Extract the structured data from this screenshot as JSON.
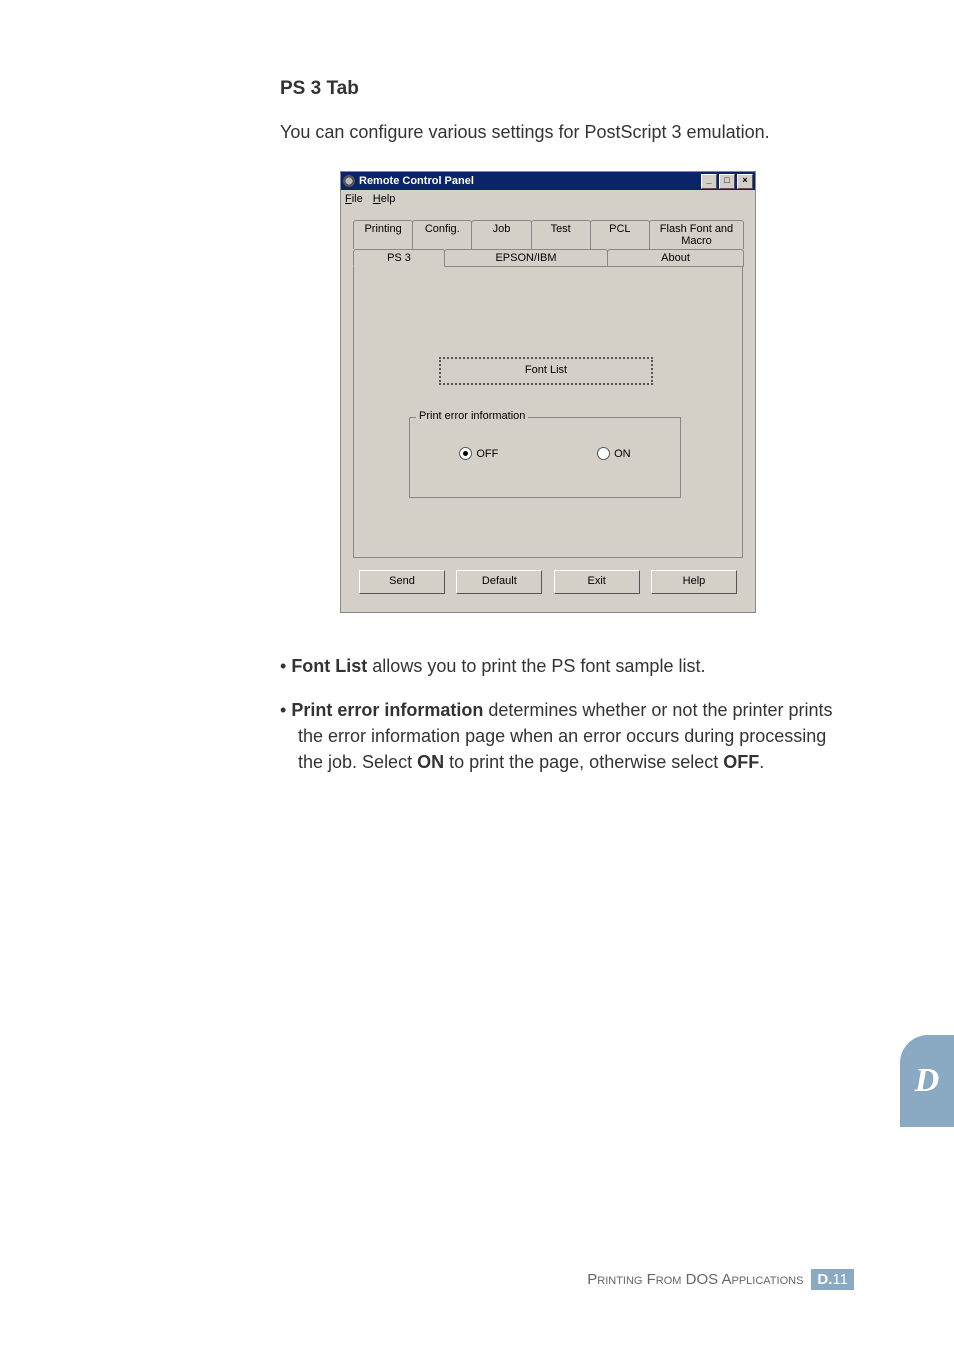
{
  "heading": "PS 3 Tab",
  "intro": "You can configure various settings for PostScript 3 emulation.",
  "window": {
    "title": "Remote Control Panel",
    "menus": {
      "file": "File",
      "help": "Help"
    },
    "win_controls": {
      "min": "_",
      "max": "□",
      "close": "×"
    },
    "tabs_row1": [
      "Printing",
      "Config.",
      "Job",
      "Test",
      "PCL",
      "Flash Font and Macro"
    ],
    "tabs_row2": [
      "PS 3",
      "EPSON/IBM",
      "About"
    ],
    "active_tab": "PS 3",
    "font_list_button": "Font List",
    "print_error_group": "Print error information",
    "radio_off": "OFF",
    "radio_on": "ON",
    "radio_selected": "OFF",
    "buttons": {
      "send": "Send",
      "default": "Default",
      "exit": "Exit",
      "help": "Help"
    }
  },
  "bullets": {
    "b1_bold": "Font List",
    "b1_rest": " allows you to print the PS font sample list.",
    "b2_bold": "Print error information",
    "b2_mid1": " determines whether or not the printer prints the error information page when an error occurs during processing the job. Select ",
    "b2_on": "ON",
    "b2_mid2": " to print the page, otherwise select ",
    "b2_off": "OFF",
    "b2_end": "."
  },
  "side_tab": "D",
  "footer": {
    "text": "Printing From DOS Applications",
    "badge_letter": "D.",
    "badge_num": "11"
  }
}
